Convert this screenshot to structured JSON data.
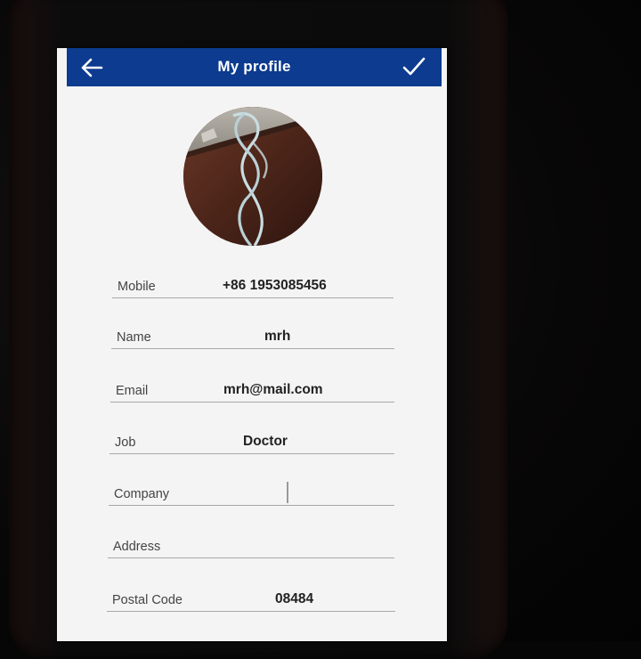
{
  "app_bar": {
    "title": "My profile",
    "color": "#0c3b8f"
  },
  "icons": {
    "back": "arrow-left-icon",
    "save": "checkmark-icon"
  },
  "fields": [
    {
      "label": "Mobile",
      "value": "+86 1953085456"
    },
    {
      "label": "Name",
      "value": "mrh"
    },
    {
      "label": "Email",
      "value": "mrh@mail.com"
    },
    {
      "label": "Job",
      "value": "Doctor"
    },
    {
      "label": "Company",
      "value": ""
    },
    {
      "label": "Address",
      "value": ""
    },
    {
      "label": "Postal Code",
      "value": "08484"
    }
  ]
}
